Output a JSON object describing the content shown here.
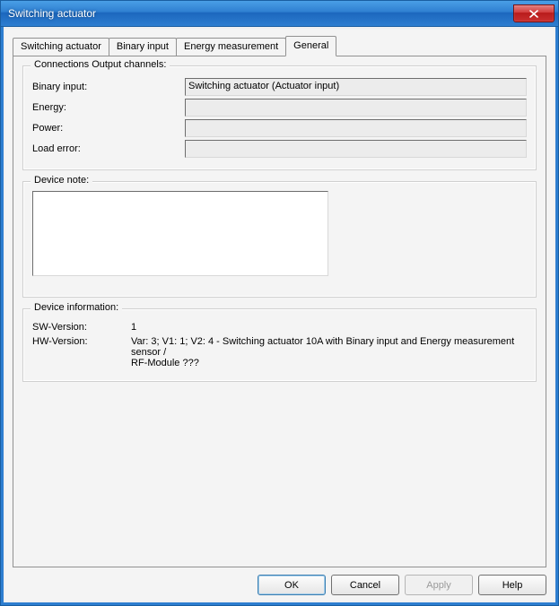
{
  "window": {
    "title": "Switching actuator"
  },
  "tabs": {
    "t0": "Switching actuator",
    "t1": "Binary input",
    "t2": "Energy measurement",
    "t3": "General"
  },
  "groups": {
    "connections": {
      "legend": "Connections Output channels:",
      "binary_input_label": "Binary input:",
      "binary_input_value": "Switching actuator (Actuator input)",
      "energy_label": "Energy:",
      "energy_value": "",
      "power_label": "Power:",
      "power_value": "",
      "load_error_label": "Load error:",
      "load_error_value": ""
    },
    "device_note": {
      "legend": "Device note:",
      "value": ""
    },
    "device_info": {
      "legend": "Device information:",
      "sw_label": "SW-Version:",
      "sw_value": "1",
      "hw_label": "HW-Version:",
      "hw_value": "Var: 3;  V1: 1;  V2: 4 - Switching actuator 10A  with Binary input and Energy measurement sensor /\nRF-Module ???"
    }
  },
  "buttons": {
    "ok": "OK",
    "cancel": "Cancel",
    "apply": "Apply",
    "help": "Help"
  }
}
